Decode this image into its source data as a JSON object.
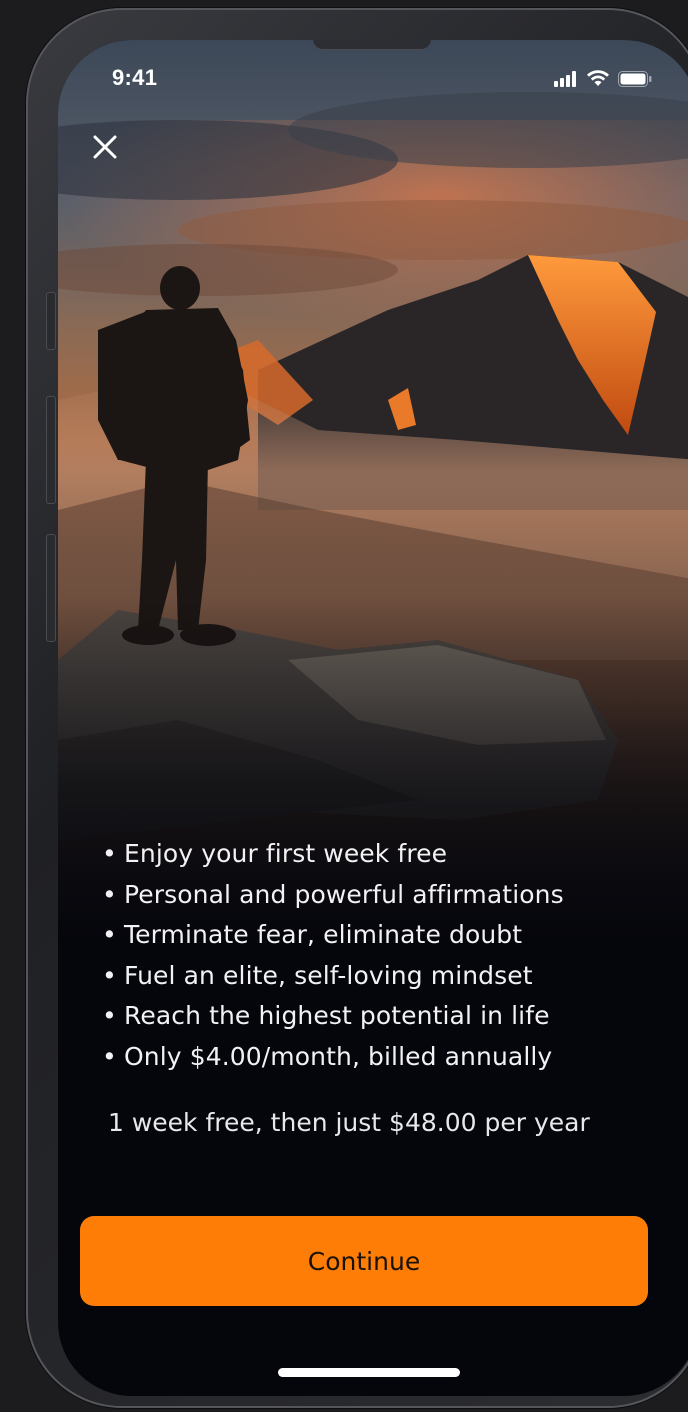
{
  "status_bar": {
    "time": "9:41",
    "signal_icon": "cellular-signal-icon",
    "wifi_icon": "wifi-icon",
    "battery_icon": "battery-icon"
  },
  "header": {
    "close_icon": "close-icon"
  },
  "hero": {
    "icon": "hiker-mountain-photo"
  },
  "features": [
    "Enjoy your first week free",
    "Personal and powerful affirmations",
    "Terminate fear, eliminate doubt",
    "Fuel an elite, self-loving mindset",
    "Reach the highest potential in life",
    "Only $4.00/month, billed annually"
  ],
  "bullet": "•",
  "offer_text": "1 week free, then just $48.00 per year",
  "continue_label": "Continue",
  "colors": {
    "accent": "#fd7d06",
    "background": "#05060c",
    "text": "#f2f2f4"
  }
}
